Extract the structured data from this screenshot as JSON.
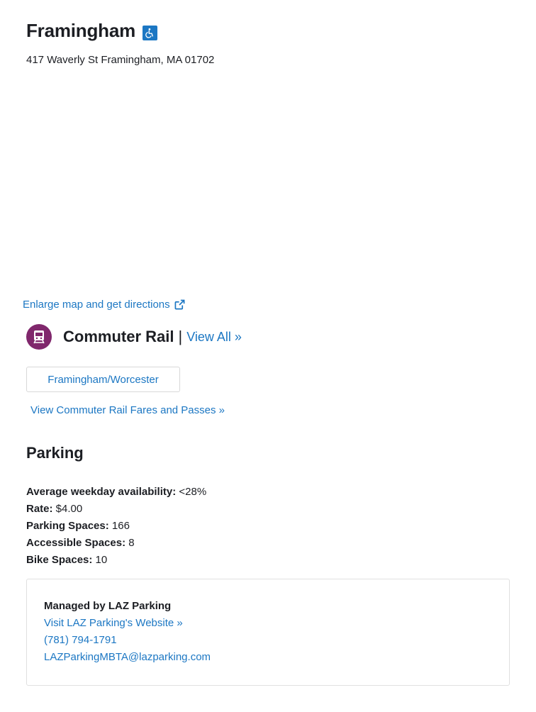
{
  "station": {
    "name": "Framingham",
    "address": "417 Waverly St Framingham, MA 01702",
    "accessible_icon": "wheelchair-accessible-icon"
  },
  "map": {
    "enlarge_link": "Enlarge map and get directions",
    "external_icon": "external-link-icon"
  },
  "commuter_rail": {
    "icon": "commuter-rail-train-icon",
    "title": "Commuter Rail",
    "separator": "|",
    "view_all": "View All »",
    "routes": [
      "Framingham/Worcester"
    ],
    "fares_link": "View Commuter Rail Fares and Passes »",
    "color": "#80276c"
  },
  "parking": {
    "heading": "Parking",
    "details": [
      {
        "label": "Average weekday availability:",
        "value": " <28%"
      },
      {
        "label": "Rate:",
        "value": " $4.00"
      },
      {
        "label": "Parking Spaces:",
        "value": " 166"
      },
      {
        "label": "Accessible Spaces:",
        "value": " 8"
      },
      {
        "label": "Bike Spaces:",
        "value": " 10"
      }
    ],
    "manager": {
      "name": "Managed by LAZ Parking",
      "website": "Visit LAZ Parking's Website »",
      "phone": "(781) 794-1791",
      "email": "LAZParkingMBTA@lazparking.com"
    }
  },
  "colors": {
    "link": "#1c77c3",
    "text": "#1c1e23",
    "accessible_badge": "#1c77c3"
  }
}
